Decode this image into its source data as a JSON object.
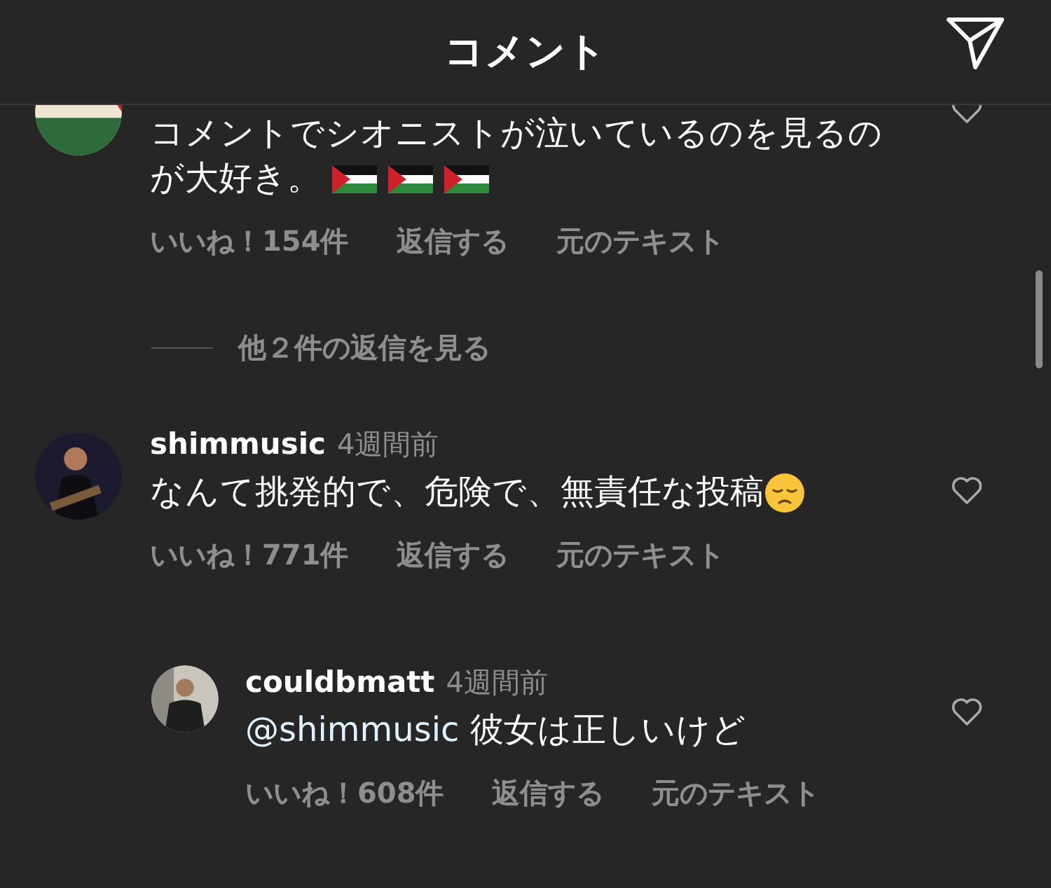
{
  "header": {
    "title": "コメント"
  },
  "comments": [
    {
      "text": "コメントでシオニストが泣いているのを見るのが大好き。",
      "emojis": [
        {
          "kind": "flag"
        },
        {
          "kind": "flag"
        },
        {
          "kind": "flag"
        }
      ],
      "likes": "いいね！154件",
      "reply": "返信する",
      "original": "元のテキスト",
      "more_replies": "他２件の返信を見る"
    },
    {
      "username": "shimmusic",
      "time": "4週間前",
      "text": "なんて挑発的で、危険で、無責任な投稿",
      "emojis": [
        {
          "kind": "sad-face"
        }
      ],
      "likes": "いいね！771件",
      "reply": "返信する",
      "original": "元のテキスト",
      "replies": [
        {
          "username": "couldbmatt",
          "time": "4週間前",
          "mention": "@shimmusic",
          "text": "彼女は正しいけど",
          "likes": "いいね！608件",
          "reply": "返信する",
          "original": "元のテキスト"
        }
      ]
    }
  ]
}
